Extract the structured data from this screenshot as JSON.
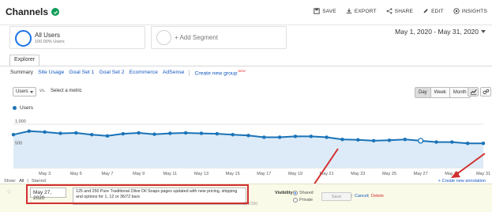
{
  "header": {
    "title": "Channels",
    "actions": [
      {
        "label": "SAVE",
        "icon": "save-icon"
      },
      {
        "label": "EXPORT",
        "icon": "export-icon"
      },
      {
        "label": "SHARE",
        "icon": "share-icon"
      },
      {
        "label": "EDIT",
        "icon": "edit-icon"
      },
      {
        "label": "INSIGHTS",
        "icon": "insights-icon"
      }
    ]
  },
  "segments": {
    "active_name": "All Users",
    "active_sub": "100.00% Users",
    "add_label": "+ Add Segment"
  },
  "date_range": "May 1, 2020 - May 31, 2020",
  "tabs": {
    "explorer": "Explorer",
    "subtabs": [
      "Summary",
      "Site Usage",
      "Goal Set 1",
      "Goal Set 2",
      "Ecommerce",
      "AdSense"
    ],
    "custom_group": "Create new group",
    "new_badge": "NEW"
  },
  "controls": {
    "metric": "Users",
    "vs": "vs.",
    "select_metric": "Select a metric",
    "periods": [
      "Day",
      "Week",
      "Month"
    ],
    "active_period": "Day"
  },
  "chart_data": {
    "type": "area",
    "series": [
      {
        "name": "Users",
        "color": "#1a73b8",
        "values": [
          760,
          840,
          820,
          790,
          800,
          760,
          730,
          780,
          800,
          770,
          790,
          800,
          790,
          780,
          760,
          740,
          700,
          700,
          720,
          720,
          700,
          650,
          640,
          620,
          630,
          650,
          620,
          590,
          590,
          560,
          560
        ]
      }
    ],
    "x_tick_labels": [
      "May 3",
      "May 5",
      "May 7",
      "May 9",
      "May 11",
      "May 13",
      "May 15",
      "May 17",
      "May 19",
      "May 21",
      "May 23",
      "May 25",
      "May 27",
      "May 29",
      "May 31"
    ],
    "y_tick_labels": [
      "1,000",
      "500"
    ],
    "ylim": [
      0,
      1200
    ],
    "grid": true
  },
  "show_bar": {
    "show": "Show:",
    "all": "All",
    "starred": "Starred",
    "create": "+ Create new annotation"
  },
  "annotation": {
    "date": "May 27, 2020",
    "text": "125 and 250 Pure Traditional Olive Oil Soaps pages updated with new pricing, shipping and options for 1, 12 or 36/72 bars",
    "count": "122/160",
    "visibility_label": "Visibility:",
    "shared": "Shared",
    "private": "Private",
    "save": "Save",
    "cancel": "Cancel",
    "delete": "Delete"
  },
  "colors": {
    "accent": "#1a73e8",
    "series": "#1a73b8",
    "area_fill": "#dcebf7",
    "highlight_red": "#d32f2f",
    "annotation_bg": "#fafae8"
  }
}
